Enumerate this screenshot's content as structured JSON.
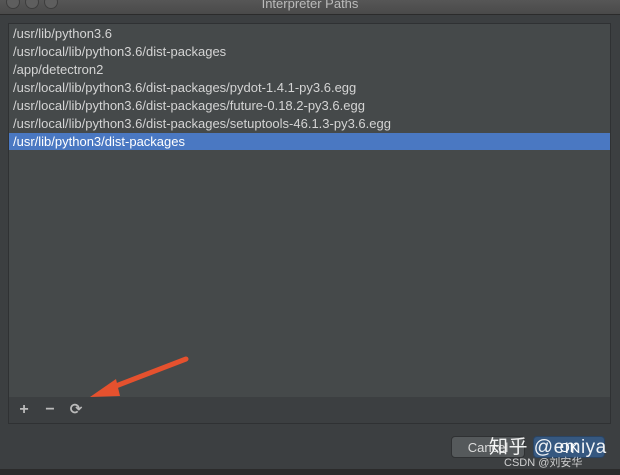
{
  "window": {
    "title": "Interpreter Paths"
  },
  "paths": [
    "/usr/lib/python3.6",
    "/usr/local/lib/python3.6/dist-packages",
    "/app/detectron2",
    "/usr/local/lib/python3.6/dist-packages/pydot-1.4.1-py3.6.egg",
    "/usr/local/lib/python3.6/dist-packages/future-0.18.2-py3.6.egg",
    "/usr/local/lib/python3.6/dist-packages/setuptools-46.1.3-py3.6.egg",
    "/usr/lib/python3/dist-packages"
  ],
  "selected_index": 6,
  "toolbar": {
    "add_icon": "plus-icon",
    "add_glyph": "+",
    "remove_icon": "minus-icon",
    "remove_glyph": "−",
    "reload_icon": "reload-icon",
    "reload_glyph": "⟳"
  },
  "buttons": {
    "cancel_label": "Cancel",
    "ok_label": "OK"
  },
  "overlays": {
    "watermark": "知乎 @emiya",
    "watermark2": "CSDN @刘安华"
  },
  "colors": {
    "selection": "#4a78c2",
    "arrow": "#e5512e"
  }
}
